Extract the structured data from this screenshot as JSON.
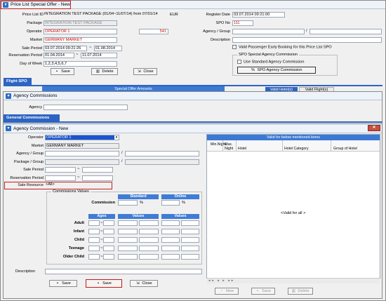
{
  "price_list_window": {
    "title": "Price List Special Offer - New",
    "price_list_label": "Price List ID",
    "price_list_value": "INTEGRATION TEST PACKAGE (01/04~11/07/14) from 07/01/14",
    "currency": "EUR",
    "package_label": "Package",
    "package_value": "INTEGRATION TEST PACKAGE",
    "operator_label": "Operator",
    "operator_value": "OPERATOR 1",
    "operator_code": "541",
    "market_label": "Market",
    "market_value": "GERMANY MARKET",
    "sale_period_label": "Sale Period",
    "sale_period_from": "03.07.2014 09:21:26",
    "sale_period_to": "01.08.2014",
    "reservation_period_label": "Reservation Period",
    "reservation_period_from": "01.04.2014",
    "reservation_period_to": "11.07.2014",
    "day_of_week_label": "Day of Week",
    "day_of_week_value": "1,2,3,4,5,6,7",
    "register_date_label": "Register Date",
    "register_date_value": "03.07.2014 09:21:00",
    "spo_no_label": "SPO No",
    "spo_no_value": "111",
    "agency_group_label": "Agency / Group",
    "description_label": "Description",
    "valid_passenger_early_booking": "Valid Passenger Early Booking for this Price List SPO",
    "spo_agency_commission_group": "SPO Special Agency Commission",
    "use_standard_agency_commission": "Use Standard Agency Commission",
    "spo_agency_commission_button": "SPO Agency Commission",
    "save": "Save",
    "delete": "Delete",
    "close": "Close",
    "flight_spo_tab": "Flight SPO",
    "special_offer_amounts": "Special Offer Amounts",
    "valid_hotels_tab": "Valid Hotel(s)",
    "valid_flights_tab": "Valid Flight(s)"
  },
  "agency_commissions_window": {
    "title": "Agency Commissions",
    "agency_label": "Agency",
    "general_commissions_tab": "General Commissions"
  },
  "agency_commission_new_window": {
    "title": "Agency Commission - New",
    "operator_label": "Operator",
    "operator_value": "OPERATOR 1",
    "market_label": "Market",
    "market_value": "GERMANY MARKET",
    "agency_group_label": "Agency / Group",
    "package_group_label": "Package / Group",
    "sale_period_label": "Sale Period",
    "reservation_period_label": "Reservation Period",
    "sale_resource_label": "Sale Resource",
    "sale_resource_value": "<All>",
    "commissions_values_label": "Commissions  Values",
    "standard_header": "Standard",
    "online_header": "Online",
    "commission_label": "Commission",
    "percent": "%",
    "ages_header": "Ages",
    "values_header": "Values",
    "age_rows": [
      "Adult",
      "Infant",
      "Child",
      "Teenage",
      "Older Child"
    ],
    "description_label": "Description",
    "save_left": "Save",
    "save_highlighted": "Save",
    "close": "Close",
    "valid_items_header": "Valid for below mentioned items",
    "columns": [
      "Min.Night",
      "Max. Night",
      "Hotel",
      "Hotel Category",
      "Group of Hotel"
    ],
    "valid_for_all": "<Valid for all >",
    "grid_new": "New",
    "grid_save": "Save",
    "grid_delete": "Delete"
  }
}
